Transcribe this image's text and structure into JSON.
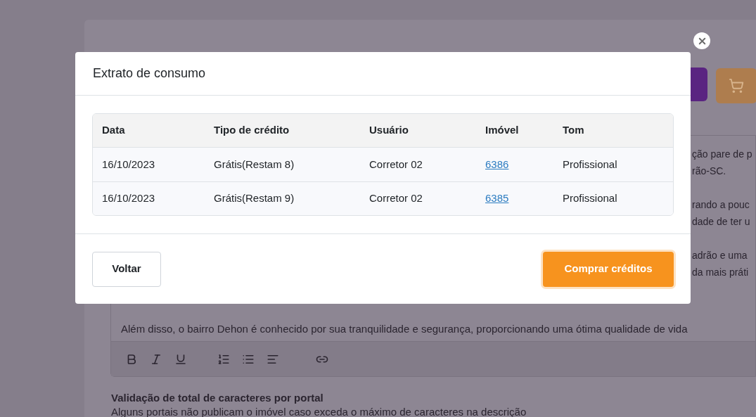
{
  "background": {
    "editor": {
      "fragments": [
        "ção pare de p",
        "rão-SC.",
        "rando a pouc",
        "dade de ter u",
        "adrão e uma",
        "da mais práti"
      ],
      "last_line": "Além disso, o bairro Dehon é conhecido por sua tranquilidade e segurança, proporcionando uma ótima qualidade de vida"
    },
    "validation": {
      "title": "Validação de total de caracteres por portal",
      "text": "Alguns portais não publicam o imóvel caso exceda o máximo de caracteres na descrição"
    }
  },
  "modal": {
    "title": "Extrato de consumo",
    "columns": [
      "Data",
      "Tipo de crédito",
      "Usuário",
      "Imóvel",
      "Tom"
    ],
    "rows": [
      {
        "date": "16/10/2023",
        "credit_type": "Grátis(Restam 8)",
        "user": "Corretor 02",
        "property": "6386",
        "tone": "Profissional"
      },
      {
        "date": "16/10/2023",
        "credit_type": "Grátis(Restam 9)",
        "user": "Corretor 02",
        "property": "6385",
        "tone": "Profissional"
      }
    ],
    "back_button": "Voltar",
    "buy_button": "Comprar créditos"
  }
}
